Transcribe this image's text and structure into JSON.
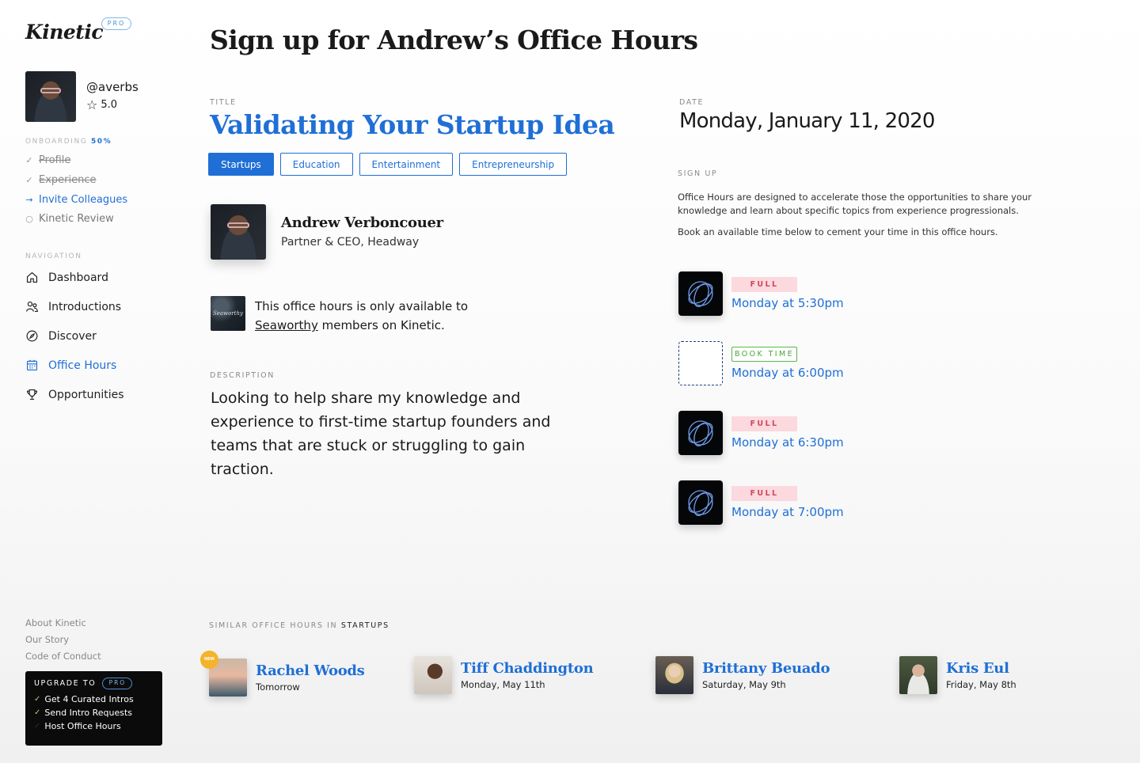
{
  "brand": {
    "logo": "Kinetic",
    "pro": "PRO"
  },
  "user": {
    "handle": "@averbs",
    "rating": "5.0"
  },
  "onboarding": {
    "label": "ONBOARDING",
    "percent": "50%",
    "items": [
      {
        "label": "Profile",
        "state": "done",
        "mark": "✓"
      },
      {
        "label": "Experience",
        "state": "done",
        "mark": "✓"
      },
      {
        "label": "Invite Colleagues",
        "state": "active",
        "mark": "→"
      },
      {
        "label": "Kinetic Review",
        "state": "pending",
        "mark": "○"
      }
    ]
  },
  "navigation": {
    "label": "NAVIGATION",
    "items": [
      {
        "label": "Dashboard",
        "icon": "home-icon"
      },
      {
        "label": "Introductions",
        "icon": "people-icon"
      },
      {
        "label": "Discover",
        "icon": "compass-icon"
      },
      {
        "label": "Office Hours",
        "icon": "calendar-icon",
        "active": true
      },
      {
        "label": "Opportunities",
        "icon": "trophy-icon"
      }
    ]
  },
  "footer_links": [
    "About Kinetic",
    "Our Story",
    "Code of Conduct"
  ],
  "upgrade": {
    "label": "UPGRADE TO",
    "pro": "PRO",
    "items": [
      "Get 4 Curated Intros",
      "Send Intro Requests",
      "Host Office Hours"
    ]
  },
  "page": {
    "title": "Sign up for Andrew’s Office Hours"
  },
  "office_hours": {
    "title_label": "TITLE",
    "title": "Validating Your Startup Idea",
    "tags": [
      {
        "label": "Startups",
        "selected": true
      },
      {
        "label": "Education",
        "selected": false
      },
      {
        "label": "Entertainment",
        "selected": false
      },
      {
        "label": "Entrepreneurship",
        "selected": false
      }
    ],
    "host": {
      "name": "Andrew Verboncouer",
      "role": "Partner & CEO, Headway"
    },
    "club": {
      "logo_text": "Seaworthy",
      "text_before": "This office hours is only available to",
      "link": "Seaworthy",
      "text_after": "members on Kinetic."
    },
    "description_label": "DESCRIPTION",
    "description": "Looking to help share my knowledge and experience to first-time startup founders and teams that are stuck or struggling to gain traction."
  },
  "schedule": {
    "date_label": "DATE",
    "date": "Monday, January 11, 2020",
    "signup_label": "SIGN UP",
    "signup_text1": "Office Hours are designed to accelerate those the opportunities to share your knowledge and learn about specific topics from experience progressionals.",
    "signup_text2": "Book an available time below to cement your time in this office hours.",
    "slots": [
      {
        "status": "FULL",
        "time": "Monday at 5:30pm",
        "type": "full"
      },
      {
        "status": "BOOK TIME",
        "time": "Monday at 6:00pm",
        "type": "book"
      },
      {
        "status": "FULL",
        "time": "Monday at 6:30pm",
        "type": "full"
      },
      {
        "status": "FULL",
        "time": "Monday at 7:00pm",
        "type": "full"
      }
    ]
  },
  "similar": {
    "label": "SIMILAR OFFICE HOURS IN",
    "category": "STARTUPS",
    "new_badge": "NEW",
    "items": [
      {
        "name": "Rachel Woods",
        "date": "Tomorrow"
      },
      {
        "name": "Tiff Chaddington",
        "date": "Monday, May 11th"
      },
      {
        "name": "Brittany Beuado",
        "date": "Saturday, May 9th"
      },
      {
        "name": "Kris Eul",
        "date": "Friday, May 8th"
      }
    ]
  },
  "colors": {
    "accent": "#1f6fd6",
    "full_bg": "#fbd9de",
    "full_text": "#d0485e",
    "book": "#4aa63a",
    "upgrade_bg": "#0b0b0b"
  }
}
